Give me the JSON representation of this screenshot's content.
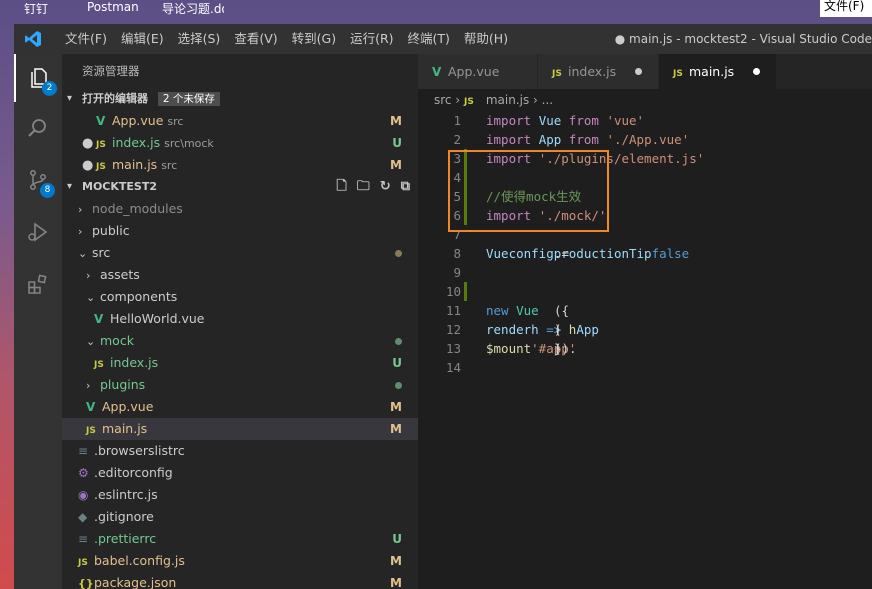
{
  "desktop": {
    "taskbar_items": [
      "钉钉",
      "Postman",
      "导论习题.docx"
    ],
    "file_button": "文件(F)"
  },
  "window": {
    "title": "● main.js - mocktest2 - Visual Studio Code",
    "menu": [
      "文件(F)",
      "编辑(E)",
      "选择(S)",
      "查看(V)",
      "转到(G)",
      "运行(R)",
      "终端(T)",
      "帮助(H)"
    ]
  },
  "activity_bar": {
    "explorer_badge": "2",
    "scm_badge": "8",
    "items": [
      "explorer-icon",
      "search-icon",
      "source-control-icon",
      "run-debug-icon",
      "extensions-icon"
    ]
  },
  "sidebar": {
    "header": "资源管理器",
    "open_editors": {
      "title": "打开的编辑器",
      "unsaved_badge": "2 个未保存",
      "items": [
        {
          "name": "App.vue",
          "desc": "src",
          "status": "M",
          "type": "vue",
          "dirty": false
        },
        {
          "name": "index.js",
          "desc": "src\\mock",
          "status": "U",
          "type": "js",
          "dirty": true
        },
        {
          "name": "main.js",
          "desc": "src",
          "status": "M",
          "type": "js",
          "dirty": true
        }
      ]
    },
    "project": {
      "title": "MOCKTEST2",
      "tree": [
        {
          "label": "node_modules",
          "kind": "folder",
          "depth": 0,
          "open": false,
          "status": ""
        },
        {
          "label": "public",
          "kind": "folder",
          "depth": 0,
          "open": false,
          "status": ""
        },
        {
          "label": "src",
          "kind": "folder",
          "depth": 0,
          "open": true,
          "status": "dot-mod"
        },
        {
          "label": "assets",
          "kind": "folder",
          "depth": 1,
          "open": false,
          "status": ""
        },
        {
          "label": "components",
          "kind": "folder",
          "depth": 1,
          "open": true,
          "status": ""
        },
        {
          "label": "HelloWorld.vue",
          "kind": "vue",
          "depth": 2,
          "open": false,
          "status": ""
        },
        {
          "label": "mock",
          "kind": "folder",
          "depth": 1,
          "open": true,
          "status": "dot-unt"
        },
        {
          "label": "index.js",
          "kind": "js",
          "depth": 2,
          "open": false,
          "status": "U"
        },
        {
          "label": "plugins",
          "kind": "folder",
          "depth": 1,
          "open": false,
          "status": "dot-unt"
        },
        {
          "label": "App.vue",
          "kind": "vue",
          "depth": 1,
          "open": false,
          "status": "M"
        },
        {
          "label": "main.js",
          "kind": "js",
          "depth": 1,
          "open": false,
          "status": "M"
        },
        {
          "label": ".browserslistrc",
          "kind": "cfg",
          "depth": 0,
          "open": false,
          "status": ""
        },
        {
          "label": ".editorconfig",
          "kind": "gear",
          "depth": 0,
          "open": false,
          "status": ""
        },
        {
          "label": ".eslintrc.js",
          "kind": "eslint",
          "depth": 0,
          "open": false,
          "status": ""
        },
        {
          "label": ".gitignore",
          "kind": "git",
          "depth": 0,
          "open": false,
          "status": ""
        },
        {
          "label": ".prettierrc",
          "kind": "cfg",
          "depth": 0,
          "open": false,
          "status": "U"
        },
        {
          "label": "babel.config.js",
          "kind": "js",
          "depth": 0,
          "open": false,
          "status": "M"
        },
        {
          "label": "package.json",
          "kind": "json",
          "depth": 0,
          "open": false,
          "status": "M"
        }
      ]
    }
  },
  "tabs": [
    {
      "label": "App.vue",
      "type": "vue",
      "active": false,
      "dirty": false
    },
    {
      "label": "index.js",
      "type": "js",
      "active": false,
      "dirty": true
    },
    {
      "label": "main.js",
      "type": "js",
      "active": true,
      "dirty": true
    }
  ],
  "breadcrumb": [
    "src",
    "main.js",
    "..."
  ],
  "code_lines": [
    {
      "n": "1",
      "gutter": false,
      "tokens": [
        [
          "imp",
          "import "
        ],
        [
          "var",
          "Vue "
        ],
        [
          "imp",
          "from "
        ],
        [
          "str",
          "'vue'"
        ]
      ]
    },
    {
      "n": "2",
      "gutter": false,
      "tokens": [
        [
          "imp",
          "import "
        ],
        [
          "var",
          "App "
        ],
        [
          "imp",
          "from "
        ],
        [
          "str",
          "'./App.vue'"
        ]
      ]
    },
    {
      "n": "3",
      "gutter": true,
      "tokens": [
        [
          "imp",
          "import "
        ],
        [
          "str",
          "'./plugins/element.js'"
        ]
      ]
    },
    {
      "n": "4",
      "gutter": true,
      "tokens": []
    },
    {
      "n": "5",
      "gutter": true,
      "tokens": [
        [
          "cmt",
          "//使得mock生效"
        ]
      ]
    },
    {
      "n": "6",
      "gutter": true,
      "tokens": [
        [
          "imp",
          "import "
        ],
        [
          "str",
          "'./mock/'"
        ]
      ]
    },
    {
      "n": "7",
      "gutter": false,
      "tokens": []
    },
    {
      "n": "8",
      "gutter": false,
      "tokens": [
        [
          "var",
          "Vue"
        ],
        [
          "txt",
          "."
        ],
        [
          "var",
          "config"
        ],
        [
          "txt",
          "."
        ],
        [
          "var",
          "productionTip"
        ],
        [
          "txt",
          " = "
        ],
        [
          "kw",
          "false"
        ]
      ]
    },
    {
      "n": "9",
      "gutter": false,
      "tokens": []
    },
    {
      "n": "10",
      "gutter": true,
      "tokens": []
    },
    {
      "n": "11",
      "gutter": false,
      "tokens": [
        [
          "kw",
          "new "
        ],
        [
          "cls",
          "Vue"
        ],
        [
          "txt",
          "({"
        ]
      ]
    },
    {
      "n": "12",
      "gutter": false,
      "tokens": [
        [
          "txt",
          "  "
        ],
        [
          "var",
          "render"
        ],
        [
          "txt",
          ": "
        ],
        [
          "var",
          "h"
        ],
        [
          "kw",
          " => "
        ],
        [
          "fn",
          "h"
        ],
        [
          "txt",
          "("
        ],
        [
          "var",
          "App"
        ],
        [
          "txt",
          ")"
        ]
      ]
    },
    {
      "n": "13",
      "gutter": false,
      "tokens": [
        [
          "txt",
          "})."
        ],
        [
          "fn",
          "$mount"
        ],
        [
          "txt",
          "("
        ],
        [
          "str",
          "'#app'"
        ],
        [
          "txt",
          ")"
        ]
      ]
    },
    {
      "n": "14",
      "gutter": false,
      "tokens": []
    }
  ]
}
